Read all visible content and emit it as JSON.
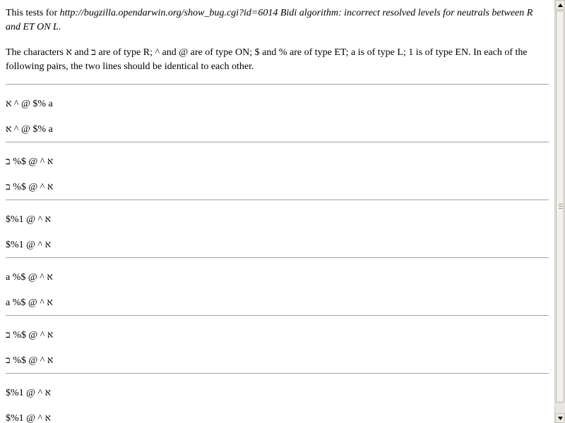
{
  "intro": {
    "prefix": "This tests for ",
    "link_text": "http://bugzilla.opendarwin.org/show_bug.cgi?id=6014 Bidi algorithm: incorrect resolved levels for neutrals between R and ET ON L",
    "suffix": "."
  },
  "description": "The characters א and ב are of type R; ^ and @ are of type ON; $ and % are of type ET; a is of type L; 1 is of type EN. In each of the following pairs, the two lines should be identical to each other.",
  "pairs": [
    {
      "line1": "א ^ @ $% a",
      "line2": "א ^ @ $% a"
    },
    {
      "line1": "ב %$ @ ^ א",
      "line2": "ב %$ @ ^ א"
    },
    {
      "line1": "$%1 @ ^ א",
      "line2": "$%1 @ ^ א"
    },
    {
      "line1": "a %$ @ ^ א",
      "line2": "a %$ @ ^ א"
    },
    {
      "line1": "ב %$ @ ^ א",
      "line2": "ב %$ @ ^ א"
    },
    {
      "line1": "$%1 @ ^ א",
      "line2": "$%1 @ ^ א"
    }
  ],
  "scrollbar": {
    "up_icon": "arrow-up",
    "down_icon": "arrow-down"
  }
}
